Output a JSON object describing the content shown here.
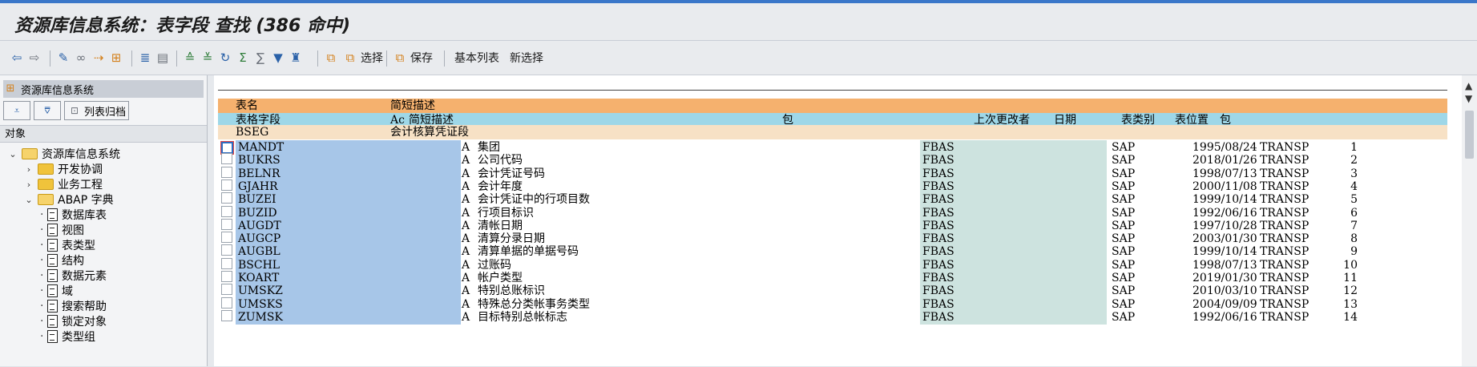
{
  "title": "资源库信息系统：表字段 查找 (386 命中)",
  "toolbar": {
    "buttons": [
      {
        "icon": "back-icon",
        "glyph": "⇦"
      },
      {
        "icon": "forward-icon",
        "glyph": "⇨"
      },
      {
        "icon": "edit-pencil-icon",
        "glyph": "✎"
      },
      {
        "icon": "display-glasses-icon",
        "glyph": "∞"
      },
      {
        "icon": "where-used-icon",
        "glyph": "⇢"
      },
      {
        "icon": "hierarchy-icon",
        "glyph": "⊞"
      },
      {
        "icon": "align-list-icon",
        "glyph": "≣"
      },
      {
        "icon": "details-icon",
        "glyph": "▤"
      },
      {
        "icon": "sort-ascending-icon",
        "glyph": "≙"
      },
      {
        "icon": "sort-descending-icon",
        "glyph": "≚"
      },
      {
        "icon": "refresh-icon",
        "glyph": "↻"
      },
      {
        "icon": "total-icon",
        "glyph": "Σ"
      },
      {
        "icon": "subtotal-icon",
        "glyph": "∑"
      },
      {
        "icon": "filter-icon",
        "glyph": "▼"
      },
      {
        "icon": "find-binoculars-icon",
        "glyph": "♜"
      },
      {
        "icon": "copy-icon",
        "glyph": "⧉"
      }
    ],
    "select_label": "选择",
    "save_label": "保存",
    "basic_list_label": "基本列表",
    "new_select_label": "新选择"
  },
  "sidebar": {
    "header": "资源库信息系统",
    "list_archive_label": "列表归档",
    "objects_label": "对象",
    "tree": [
      {
        "label": "资源库信息系统",
        "level": 0,
        "type": "folder",
        "expanded": true
      },
      {
        "label": "开发协调",
        "level": 1,
        "type": "folder",
        "expanded": false
      },
      {
        "label": "业务工程",
        "level": 1,
        "type": "folder",
        "expanded": false
      },
      {
        "label": "ABAP 字典",
        "level": 1,
        "type": "folder",
        "expanded": true
      },
      {
        "label": "数据库表",
        "level": 2,
        "type": "doc"
      },
      {
        "label": "视图",
        "level": 2,
        "type": "doc"
      },
      {
        "label": "表类型",
        "level": 2,
        "type": "doc"
      },
      {
        "label": "结构",
        "level": 2,
        "type": "doc"
      },
      {
        "label": "数据元素",
        "level": 2,
        "type": "doc"
      },
      {
        "label": "域",
        "level": 2,
        "type": "doc"
      },
      {
        "label": "搜索帮助",
        "level": 2,
        "type": "doc"
      },
      {
        "label": "锁定对象",
        "level": 2,
        "type": "doc"
      },
      {
        "label": "类型组",
        "level": 2,
        "type": "doc"
      }
    ]
  },
  "list": {
    "header1": {
      "name": "表名",
      "desc": "简短描述"
    },
    "header2": {
      "field": "表格字段",
      "ac": "Ac",
      "desc": "简短描述",
      "pkg": "包",
      "user": "上次更改者",
      "date": "日期",
      "cls": "表类别",
      "pos": "表位置",
      "extra": "包"
    },
    "group": {
      "table": "BSEG",
      "desc": "会计核算凭证段"
    },
    "rows": [
      {
        "field": "MANDT",
        "ac": "A",
        "desc": "集团",
        "pkg": "FBAS",
        "user": "SAP",
        "date": "1995/08/24",
        "cls": "TRANSP",
        "pos": "1"
      },
      {
        "field": "BUKRS",
        "ac": "A",
        "desc": "公司代码",
        "pkg": "FBAS",
        "user": "SAP",
        "date": "2018/01/26",
        "cls": "TRANSP",
        "pos": "2"
      },
      {
        "field": "BELNR",
        "ac": "A",
        "desc": "会计凭证号码",
        "pkg": "FBAS",
        "user": "SAP",
        "date": "1998/07/13",
        "cls": "TRANSP",
        "pos": "3"
      },
      {
        "field": "GJAHR",
        "ac": "A",
        "desc": "会计年度",
        "pkg": "FBAS",
        "user": "SAP",
        "date": "2000/11/08",
        "cls": "TRANSP",
        "pos": "4"
      },
      {
        "field": "BUZEI",
        "ac": "A",
        "desc": "会计凭证中的行项目数",
        "pkg": "FBAS",
        "user": "SAP",
        "date": "1999/10/14",
        "cls": "TRANSP",
        "pos": "5"
      },
      {
        "field": "BUZID",
        "ac": "A",
        "desc": "行项目标识",
        "pkg": "FBAS",
        "user": "SAP",
        "date": "1992/06/16",
        "cls": "TRANSP",
        "pos": "6"
      },
      {
        "field": "AUGDT",
        "ac": "A",
        "desc": "清帐日期",
        "pkg": "FBAS",
        "user": "SAP",
        "date": "1997/10/28",
        "cls": "TRANSP",
        "pos": "7"
      },
      {
        "field": "AUGCP",
        "ac": "A",
        "desc": "清算分录日期",
        "pkg": "FBAS",
        "user": "SAP",
        "date": "2003/01/30",
        "cls": "TRANSP",
        "pos": "8"
      },
      {
        "field": "AUGBL",
        "ac": "A",
        "desc": "清算单据的单据号码",
        "pkg": "FBAS",
        "user": "SAP",
        "date": "1999/10/14",
        "cls": "TRANSP",
        "pos": "9"
      },
      {
        "field": "BSCHL",
        "ac": "A",
        "desc": "过账码",
        "pkg": "FBAS",
        "user": "SAP",
        "date": "1998/07/13",
        "cls": "TRANSP",
        "pos": "10"
      },
      {
        "field": "KOART",
        "ac": "A",
        "desc": "帐户类型",
        "pkg": "FBAS",
        "user": "SAP",
        "date": "2019/01/30",
        "cls": "TRANSP",
        "pos": "11"
      },
      {
        "field": "UMSKZ",
        "ac": "A",
        "desc": "特别总账标识",
        "pkg": "FBAS",
        "user": "SAP",
        "date": "2010/03/10",
        "cls": "TRANSP",
        "pos": "12"
      },
      {
        "field": "UMSKS",
        "ac": "A",
        "desc": "特殊总分类帐事务类型",
        "pkg": "FBAS",
        "user": "SAP",
        "date": "2004/09/09",
        "cls": "TRANSP",
        "pos": "13"
      },
      {
        "field": "ZUMSK",
        "ac": "A",
        "desc": "目标特别总帐标志",
        "pkg": "FBAS",
        "user": "SAP",
        "date": "1992/06/16",
        "cls": "TRANSP",
        "pos": "14"
      }
    ]
  }
}
